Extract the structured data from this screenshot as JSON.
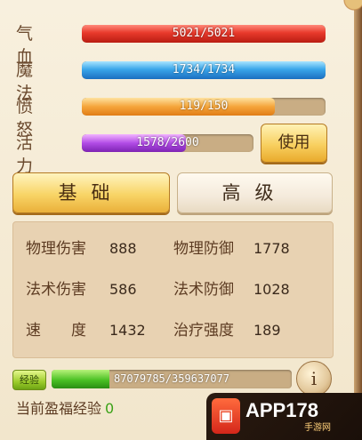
{
  "stats": [
    {
      "label": "气血",
      "text": "5021/5021",
      "current": 5021,
      "max": 5021,
      "color": "#e8392b"
    },
    {
      "label": "魔法",
      "text": "1734/1734",
      "current": 1734,
      "max": 1734,
      "color": "#3aa6ea"
    },
    {
      "label": "愤怒",
      "text": "119/150",
      "current": 119,
      "max": 150,
      "color": "#f5a53a"
    },
    {
      "label": "活力",
      "text": "1578/2600",
      "current": 1578,
      "max": 2600,
      "color": "#b24ce6"
    }
  ],
  "use_button": "使用",
  "tabs": {
    "basic": "基础",
    "advanced": "高级",
    "active": "basic"
  },
  "attributes": [
    {
      "name": "物理伤害",
      "value": "888"
    },
    {
      "name": "物理防御",
      "value": "1778"
    },
    {
      "name": "法术伤害",
      "value": "586"
    },
    {
      "name": "法术防御",
      "value": "1028"
    },
    {
      "name": "速　　度",
      "value": "1432"
    },
    {
      "name": "治疗强度",
      "value": "189"
    }
  ],
  "experience": {
    "badge": "经验",
    "text": "87079785/359637077",
    "current": 87079785,
    "max": 359637077
  },
  "info_icon_glyph": "i",
  "blessing": {
    "label": "当前盈福经验",
    "value": "0"
  },
  "watermark": {
    "logo_glyph": "▣",
    "text": "APP178",
    "sub": "手游网"
  }
}
